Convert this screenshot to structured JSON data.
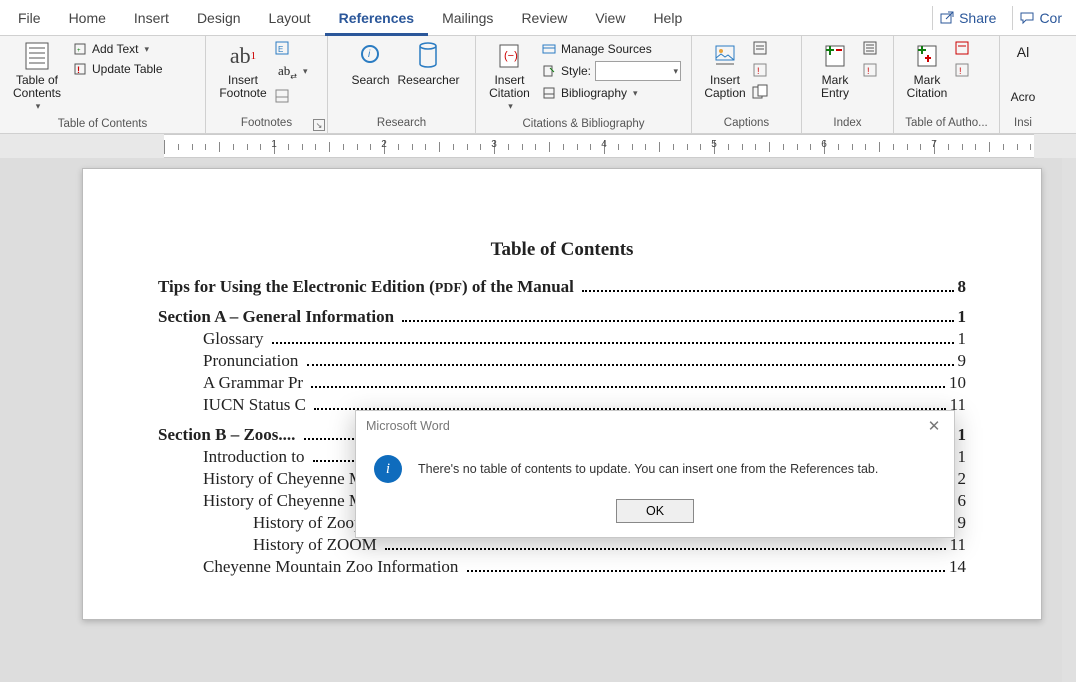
{
  "tabs": {
    "file": "File",
    "home": "Home",
    "insert": "Insert",
    "design": "Design",
    "layout": "Layout",
    "references": "References",
    "mailings": "Mailings",
    "review": "Review",
    "view": "View",
    "help": "Help",
    "share": "Share",
    "comments": "Cor"
  },
  "ribbon": {
    "toc": {
      "button": "Table of\nContents",
      "add_text": "Add Text",
      "update_table": "Update Table",
      "group": "Table of Contents"
    },
    "footnotes": {
      "insert": "Insert\nFootnote",
      "ab": "ab",
      "group": "Footnotes"
    },
    "research": {
      "search": "Search",
      "researcher": "Researcher",
      "group": "Research"
    },
    "citations": {
      "insert": "Insert\nCitation",
      "manage": "Manage Sources",
      "style": "Style:",
      "biblio": "Bibliography",
      "group": "Citations & Bibliography"
    },
    "captions": {
      "insert": "Insert\nCaption",
      "group": "Captions"
    },
    "index": {
      "mark": "Mark\nEntry",
      "group": "Index"
    },
    "authorities": {
      "mark": "Mark\nCitation",
      "group": "Table of Autho..."
    },
    "acronyms": {
      "btn": "Al",
      "label": "Acro",
      "group": "Insi"
    }
  },
  "ruler_numbers": [
    "1",
    "2",
    "3",
    "4",
    "5",
    "6",
    "7"
  ],
  "document": {
    "title": "Table of Contents",
    "entries": [
      {
        "level": "bold",
        "label": "Tips for Using the Electronic Edition (",
        "small": "PDF",
        "label2": ") of the Manual",
        "page": "8"
      },
      {
        "level": "bold",
        "label": "Section A – General Information",
        "page": "1"
      },
      {
        "level": "sub1",
        "label": "Glossary",
        "page": "1"
      },
      {
        "level": "sub1",
        "label": "Pronunciation",
        "page": "9"
      },
      {
        "level": "sub1",
        "label": "A Grammar Pr",
        "page": "10"
      },
      {
        "level": "sub1",
        "label": "IUCN Status C",
        "page": "11"
      },
      {
        "level": "bold",
        "label": "Section B – Zoos....",
        "page": "1"
      },
      {
        "level": "sub1",
        "label": "Introduction to",
        "page": "1"
      },
      {
        "level": "sub1",
        "label": "History of Cheyenne Mountain Zoological Park",
        "page": "2"
      },
      {
        "level": "sub1",
        "label": "History of Cheyenne Mountain Zoo Auxiliary",
        "page": "6"
      },
      {
        "level": "sub2",
        "label": "History of Zoopeteers",
        "page": "9"
      },
      {
        "level": "sub2",
        "label": "History of ZOOM",
        "page": "11"
      },
      {
        "level": "sub1",
        "label": "Cheyenne Mountain Zoo Information",
        "page": "14"
      }
    ]
  },
  "dialog": {
    "title": "Microsoft Word",
    "message": "There's no table of contents to update. You can insert one from the References tab.",
    "ok": "OK"
  }
}
